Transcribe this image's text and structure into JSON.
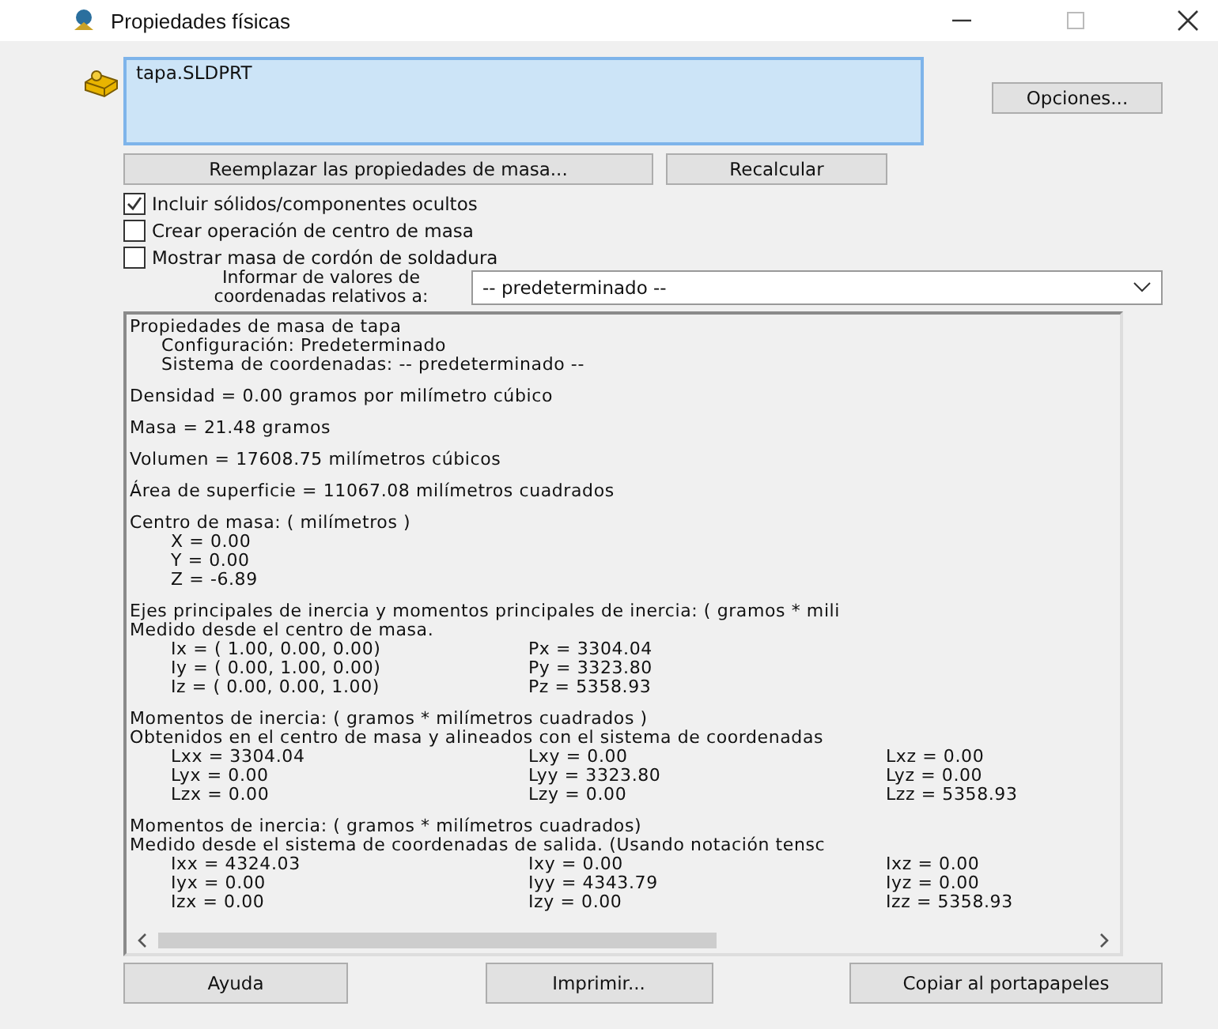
{
  "window": {
    "title": "Propiedades físicas"
  },
  "selection": {
    "items": [
      "tapa.SLDPRT"
    ]
  },
  "options_button": "Opciones...",
  "action_buttons": [
    "Reemplazar las propiedades de masa...",
    "Recalcular"
  ],
  "checkboxes": [
    {
      "label": "Incluir sólidos/componentes ocultos",
      "checked": true
    },
    {
      "label": "Crear operación de centro de masa",
      "checked": false
    },
    {
      "label": "Mostrar masa de cordón de soldadura",
      "checked": false
    }
  ],
  "coordinate_report": {
    "label": "Informar de valores de coordenadas relativos a:",
    "value": "-- predeterminado --"
  },
  "report": {
    "sections": [
      {
        "lines": [
          {
            "kind": "plain",
            "text": "Propiedades de masa de tapa"
          },
          {
            "kind": "sub",
            "text": "Configuración:  Predeterminado"
          },
          {
            "kind": "sub",
            "text": "Sistema de coordenadas:  -- predeterminado --"
          }
        ]
      },
      {
        "lines": [
          {
            "kind": "plain",
            "text": "Densidad = 0.00 gramos por milímetro cúbico"
          }
        ]
      },
      {
        "lines": [
          {
            "kind": "plain",
            "text": "Masa = 21.48 gramos"
          }
        ]
      },
      {
        "lines": [
          {
            "kind": "plain",
            "text": "Volumen = 17608.75 milímetros cúbicos"
          }
        ]
      },
      {
        "lines": [
          {
            "kind": "plain",
            "text": "Área de superficie = 11067.08  milímetros cuadrados"
          }
        ]
      },
      {
        "lines": [
          {
            "kind": "plain",
            "text": "Centro de masa: ( milímetros )"
          },
          {
            "kind": "value",
            "text": "X = 0.00"
          },
          {
            "kind": "value",
            "text": "Y = 0.00"
          },
          {
            "kind": "value",
            "text": "Z = -6.89"
          }
        ]
      },
      {
        "lines": [
          {
            "kind": "plain",
            "text": "Ejes principales de inercia y momentos principales de inercia: ( gramos *  mili"
          },
          {
            "kind": "plain",
            "text": "Medido desde el centro de masa."
          },
          {
            "kind": "grid",
            "cells": [
              "Ix = ( 1.00,  0.00,  0.00)",
              "Px = 3304.04"
            ]
          },
          {
            "kind": "grid",
            "cells": [
              "Iy = ( 0.00,  1.00,  0.00)",
              "Py = 3323.80"
            ]
          },
          {
            "kind": "grid",
            "cells": [
              "Iz = ( 0.00,  0.00,  1.00)",
              "Pz = 5358.93"
            ]
          }
        ]
      },
      {
        "lines": [
          {
            "kind": "plain",
            "text": "Momentos de inercia: ( gramos *  milímetros cuadrados )"
          },
          {
            "kind": "plain",
            "text": "Obtenidos en el centro de masa y alineados con el sistema de coordenadas"
          },
          {
            "kind": "grid",
            "cells": [
              "Lxx = 3304.04",
              "Lxy = 0.00",
              "Lxz = 0.00"
            ]
          },
          {
            "kind": "grid",
            "cells": [
              "Lyx = 0.00",
              "Lyy = 3323.80",
              "Lyz = 0.00"
            ]
          },
          {
            "kind": "grid",
            "cells": [
              "Lzx = 0.00",
              "Lzy = 0.00",
              "Lzz = 5358.93"
            ]
          }
        ]
      },
      {
        "lines": [
          {
            "kind": "plain",
            "text": "Momentos de inercia: ( gramos *  milímetros cuadrados)"
          },
          {
            "kind": "plain",
            "text": "Medido desde el sistema de coordenadas de salida. (Usando notación tensc"
          },
          {
            "kind": "grid",
            "cells": [
              "Ixx = 4324.03",
              "Ixy = 0.00",
              "Ixz = 0.00"
            ]
          },
          {
            "kind": "grid",
            "cells": [
              "Iyx = 0.00",
              "Iyy = 4343.79",
              "Iyz = 0.00"
            ]
          },
          {
            "kind": "grid",
            "cells": [
              "Izx = 0.00",
              "Izy = 0.00",
              "Izz = 5358.93"
            ]
          }
        ]
      }
    ]
  },
  "footer_buttons": [
    "Ayuda",
    "Imprimir...",
    "Copiar al portapapeles"
  ]
}
